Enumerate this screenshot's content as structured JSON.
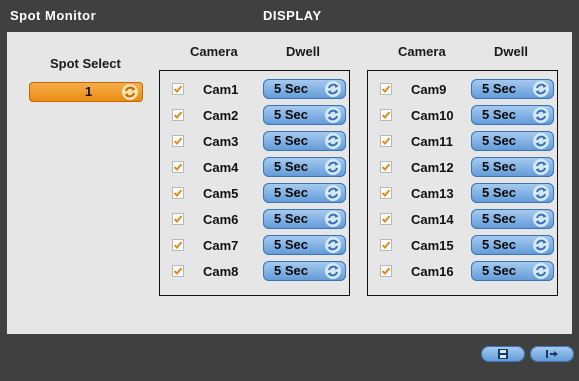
{
  "window": {
    "title": "Spot Monitor",
    "section": "DISPLAY"
  },
  "spot_select": {
    "label": "Spot Select",
    "value": "1"
  },
  "groups": [
    {
      "camera_header": "Camera",
      "dwell_header": "Dwell",
      "rows": [
        {
          "camera": "Cam1",
          "checked": true,
          "dwell": "5 Sec"
        },
        {
          "camera": "Cam2",
          "checked": true,
          "dwell": "5 Sec"
        },
        {
          "camera": "Cam3",
          "checked": true,
          "dwell": "5 Sec"
        },
        {
          "camera": "Cam4",
          "checked": true,
          "dwell": "5 Sec"
        },
        {
          "camera": "Cam5",
          "checked": true,
          "dwell": "5 Sec"
        },
        {
          "camera": "Cam6",
          "checked": true,
          "dwell": "5 Sec"
        },
        {
          "camera": "Cam7",
          "checked": true,
          "dwell": "5 Sec"
        },
        {
          "camera": "Cam8",
          "checked": true,
          "dwell": "5 Sec"
        }
      ]
    },
    {
      "camera_header": "Camera",
      "dwell_header": "Dwell",
      "rows": [
        {
          "camera": "Cam9",
          "checked": true,
          "dwell": "5 Sec"
        },
        {
          "camera": "Cam10",
          "checked": true,
          "dwell": "5 Sec"
        },
        {
          "camera": "Cam11",
          "checked": true,
          "dwell": "5 Sec"
        },
        {
          "camera": "Cam12",
          "checked": true,
          "dwell": "5 Sec"
        },
        {
          "camera": "Cam13",
          "checked": true,
          "dwell": "5 Sec"
        },
        {
          "camera": "Cam14",
          "checked": true,
          "dwell": "5 Sec"
        },
        {
          "camera": "Cam15",
          "checked": true,
          "dwell": "5 Sec"
        },
        {
          "camera": "Cam16",
          "checked": true,
          "dwell": "5 Sec"
        }
      ]
    }
  ],
  "buttons": {
    "save_icon": "save-icon",
    "exit_icon": "exit-icon"
  },
  "colors": {
    "background": "#404040",
    "panel": "#e6e6e6",
    "checkmark": "#e8871a",
    "dwell_button": "#6fa6de",
    "spot_select": "#f0a033"
  }
}
